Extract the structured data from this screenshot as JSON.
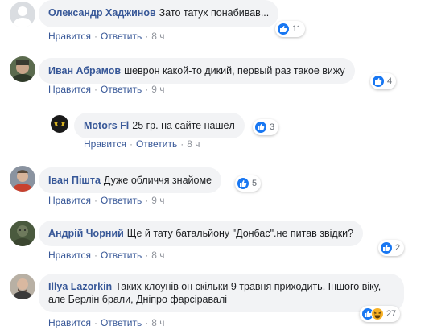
{
  "comments": [
    {
      "name": "Олександр Хаджинов",
      "text": "Зато татух понабивав...",
      "reactions": "11",
      "like": "Нравится",
      "reply": "Ответить",
      "time": "8 ч"
    },
    {
      "name": "Иван Абрамов",
      "text": "шеврон какой-то дикий, первый раз такое вижу",
      "reactions": "4",
      "like": "Нравится",
      "reply": "Ответить",
      "time": "9 ч"
    },
    {
      "name": "Motors Fl",
      "text": "25 гр. на сайте нашёл",
      "reactions": "3",
      "like": "Нравится",
      "reply": "Ответить",
      "time": "8 ч"
    },
    {
      "name": "Іван Пішта",
      "text": "Дуже обличчя знайоме",
      "reactions": "5",
      "like": "Нравится",
      "reply": "Ответить",
      "time": "9 ч"
    },
    {
      "name": "Андрій Чорний",
      "text": "Ще й тату батальйону \"Донбас\".не питав звідки?",
      "reactions": "2",
      "like": "Нравится",
      "reply": "Ответить",
      "time": "8 ч"
    },
    {
      "name": "Illya Lazorkin",
      "text": "Таких клоунів он скільки 9 травня приходить. Іншого віку, але Берлін брали, Дніпро фарсіравалі",
      "reactions": "27",
      "like": "Нравится",
      "reply": "Ответить",
      "time": "8 ч"
    }
  ],
  "separator": "·",
  "colors": {
    "link": "#385898",
    "bubble": "#f2f3f5",
    "meta": "#90949c",
    "like_blue": "#1877f2",
    "haha_yellow": "#f7b125"
  }
}
